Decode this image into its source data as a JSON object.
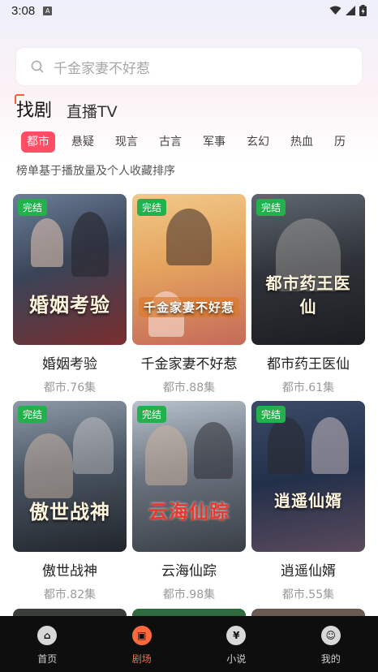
{
  "status": {
    "time": "3:08",
    "notif": "A"
  },
  "search": {
    "placeholder": "千金家妻不好惹"
  },
  "main_tabs": [
    {
      "label": "找剧"
    },
    {
      "label": "直播TV"
    }
  ],
  "categories": [
    {
      "label": "都市"
    },
    {
      "label": "悬疑"
    },
    {
      "label": "现言"
    },
    {
      "label": "古言"
    },
    {
      "label": "军事"
    },
    {
      "label": "玄幻"
    },
    {
      "label": "热血"
    },
    {
      "label": "历"
    }
  ],
  "sort_note": "榜单基于播放量及个人收藏排序",
  "dramas": [
    {
      "badge": "完结",
      "art": "婚姻考验",
      "title": "婚姻考验",
      "meta": "都市.76集"
    },
    {
      "badge": "完结",
      "art": "千金家妻不好惹",
      "title": "千金家妻不好惹",
      "meta": "都市.88集"
    },
    {
      "badge": "完结",
      "art": "都市药王医仙",
      "title": "都市药王医仙",
      "meta": "都市.61集"
    },
    {
      "badge": "完结",
      "art": "傲世战神",
      "title": "傲世战神",
      "meta": "都市.82集"
    },
    {
      "badge": "完结",
      "art": "云海仙踪",
      "title": "云海仙踪",
      "meta": "都市.98集"
    },
    {
      "badge": "完结",
      "art": "逍遥仙婿",
      "title": "逍遥仙婿",
      "meta": "都市.55集"
    }
  ],
  "bottom_nav": [
    {
      "label": "首页",
      "icon": "home-icon",
      "glyph": "⌂"
    },
    {
      "label": "剧场",
      "icon": "theater-icon",
      "glyph": "▣"
    },
    {
      "label": "小说",
      "icon": "novel-icon",
      "glyph": "¥"
    },
    {
      "label": "我的",
      "icon": "profile-icon",
      "glyph": "☺"
    }
  ],
  "colors": {
    "accent": "#ff6a3d",
    "category_active": "#ff4d63",
    "badge": "#22b14c",
    "nav_background": "#0e0e0e"
  }
}
